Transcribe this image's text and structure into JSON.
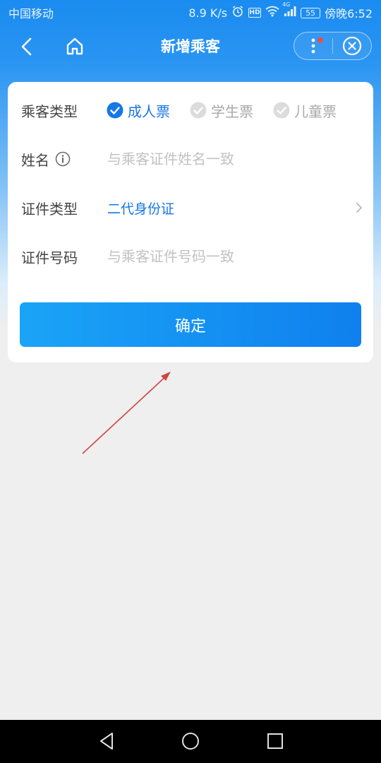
{
  "status_bar": {
    "carrier": "中国移动",
    "speed": "8.9 K/s",
    "hd": "HD",
    "network": "4G",
    "battery": "55",
    "time": "傍晚6:52"
  },
  "nav": {
    "title": "新增乘客"
  },
  "form": {
    "ticket_type": {
      "label": "乘客类型",
      "options": [
        {
          "label": "成人票",
          "selected": true
        },
        {
          "label": "学生票",
          "selected": false
        },
        {
          "label": "儿童票",
          "selected": false
        }
      ]
    },
    "name": {
      "label": "姓名",
      "placeholder": "与乘客证件姓名一致",
      "value": ""
    },
    "id_type": {
      "label": "证件类型",
      "value": "二代身份证"
    },
    "id_number": {
      "label": "证件号码",
      "placeholder": "与乘客证件号码一致",
      "value": ""
    },
    "confirm_label": "确定"
  },
  "colors": {
    "accent": "#1677e6",
    "header": "#1a8bf0",
    "annotation": "#d04545"
  }
}
